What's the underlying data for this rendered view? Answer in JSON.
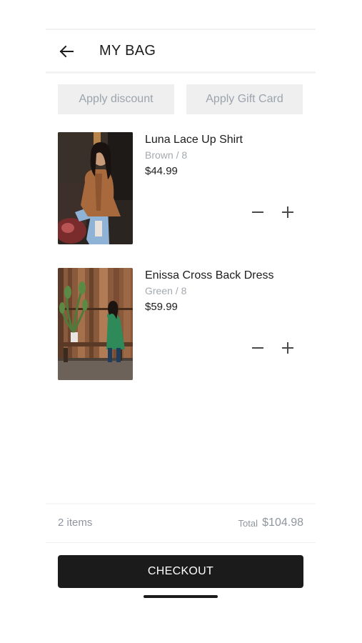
{
  "header": {
    "title": "MY BAG",
    "back_icon": "arrow-left-icon"
  },
  "actions": {
    "discount_label": "Apply discount",
    "gift_card_label": "Apply Gift Card"
  },
  "items": [
    {
      "name": "Luna Lace Up Shirt",
      "variant": "Brown / 8",
      "price": "$44.99",
      "image": "model-in-brown-shirt-photo"
    },
    {
      "name": "Enissa Cross Back Dress",
      "variant": "Green / 8",
      "price": "$59.99",
      "image": "model-in-green-dress-photo"
    }
  ],
  "summary": {
    "count": "2 items",
    "total_label": "Total",
    "total_value": "$104.98"
  },
  "checkout": {
    "label": "CHECKOUT"
  },
  "colors": {
    "checkout_bg": "#1b1b1b",
    "muted_text": "#a4a9ae",
    "button_bg": "#efefef"
  }
}
